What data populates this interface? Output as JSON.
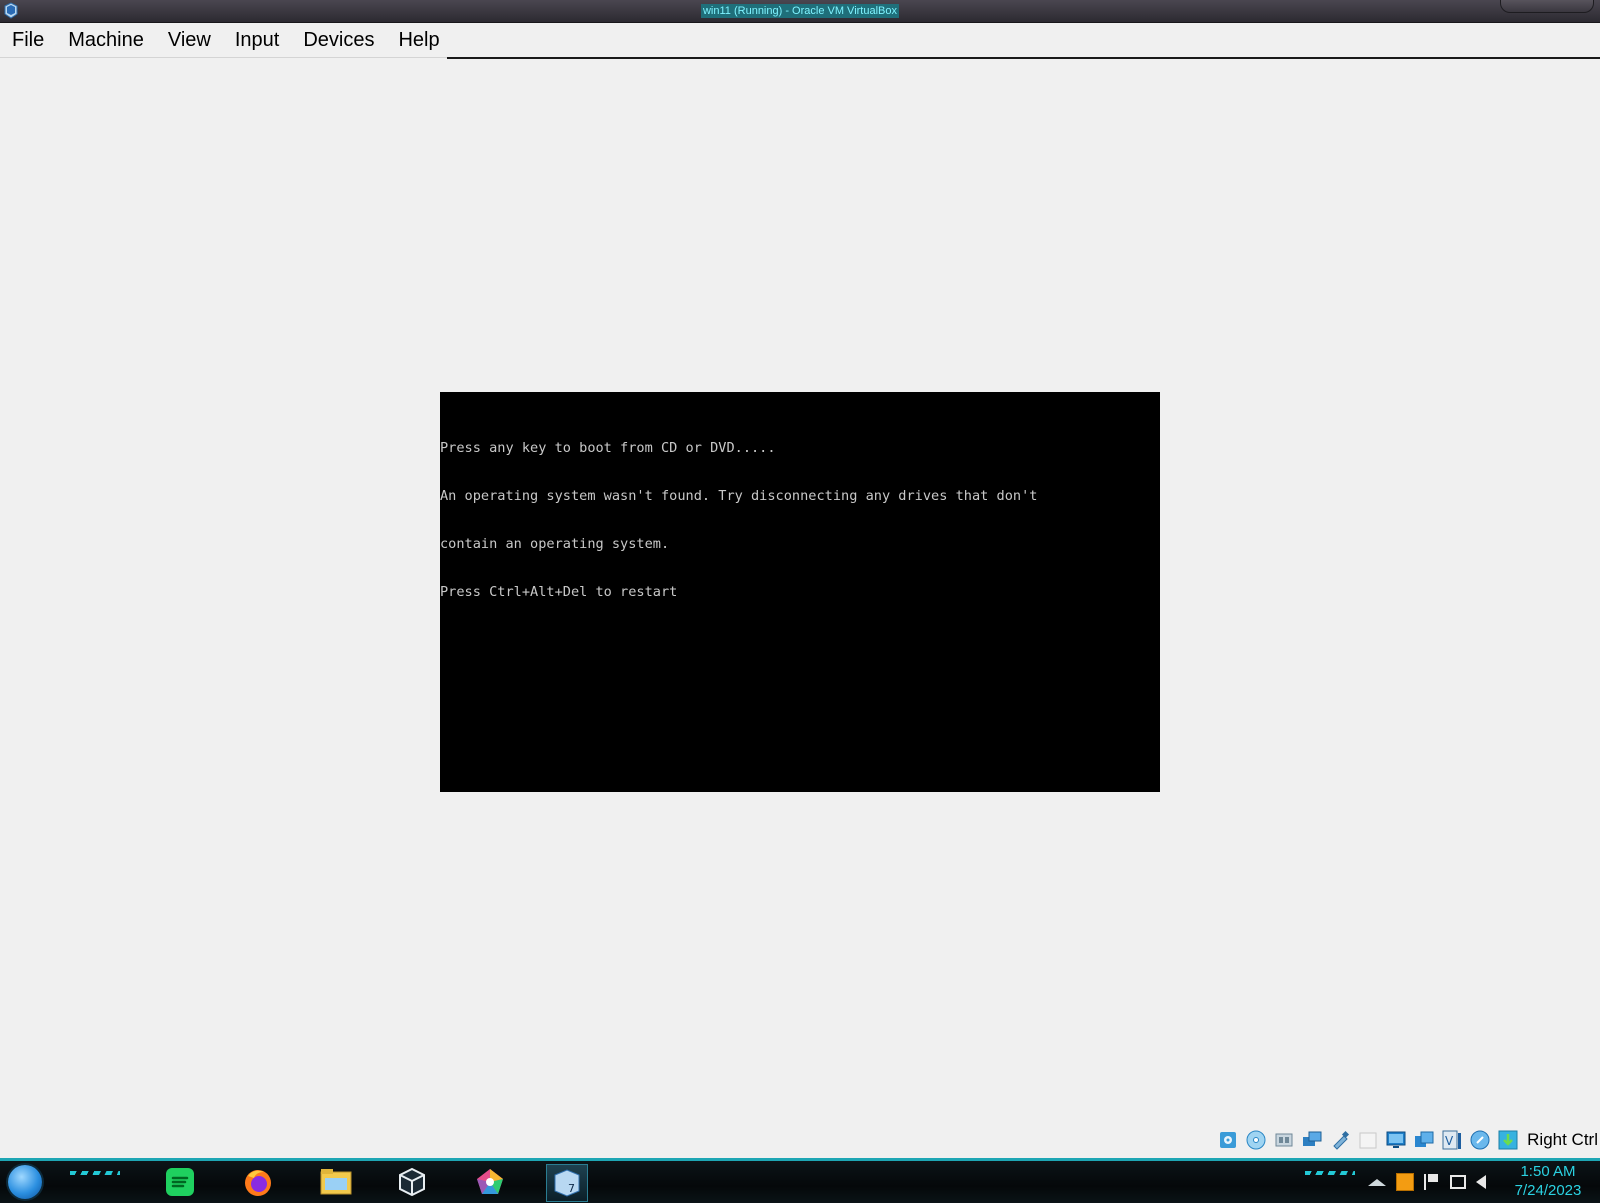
{
  "window": {
    "title": "win11 (Running) - Oracle VM VirtualBox",
    "app_icon": "virtualbox-icon"
  },
  "menubar": {
    "items": [
      "File",
      "Machine",
      "View",
      "Input",
      "Devices",
      "Help"
    ]
  },
  "vm_console": {
    "lines": [
      "Press any key to boot from CD or DVD.....",
      "An operating system wasn't found. Try disconnecting any drives that don't",
      "contain an operating system.",
      "Press Ctrl+Alt+Del to restart"
    ]
  },
  "statusbar": {
    "icons": [
      "hard-disk-icon",
      "optical-drive-icon",
      "audio-icon",
      "network-icon",
      "usb-icon",
      "shared-folders-icon",
      "display-icon",
      "video-capture-icon",
      "virtualization-icon",
      "mouse-integration-icon",
      "keyboard-capture-icon"
    ],
    "host_key": "Right Ctrl"
  },
  "taskbar": {
    "apps": [
      "spotify-icon",
      "firefox-icon",
      "file-explorer-icon",
      "virtualbox-icon",
      "pentagon-app-icon",
      "virtualbox-manager-icon"
    ],
    "tray_icons": [
      "show-hidden-icon",
      "security-icon",
      "action-center-flag-icon",
      "network-tray-icon",
      "volume-icon"
    ],
    "clock": {
      "time": "1:50 AM",
      "date": "7/24/2023"
    }
  }
}
